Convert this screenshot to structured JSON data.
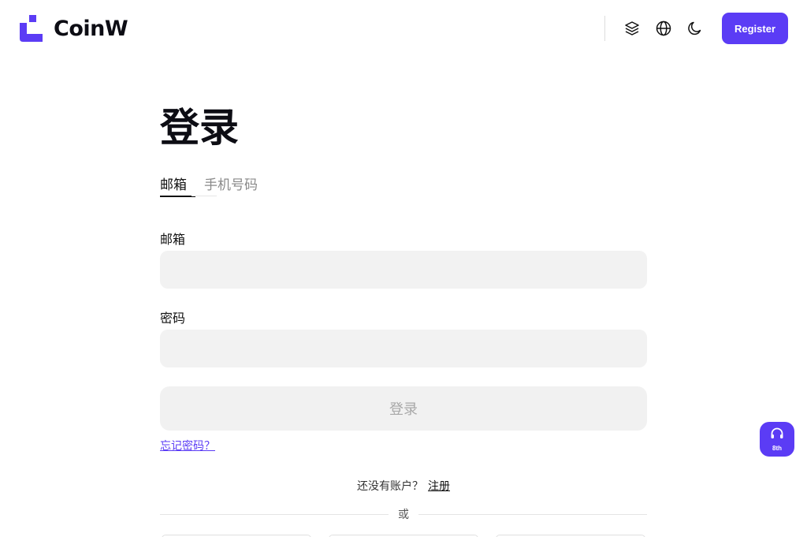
{
  "header": {
    "brand_name": "CoinW",
    "brand_color": "#5b3cf5",
    "icons": [
      "layers-icon",
      "globe-icon",
      "moon-icon"
    ],
    "register_label": "Register"
  },
  "main": {
    "title": "登录",
    "tabs": [
      {
        "label": "邮箱",
        "active": true
      },
      {
        "label": "手机号码",
        "active": false
      }
    ],
    "fields": [
      {
        "label": "邮箱",
        "value": "",
        "placeholder": ""
      },
      {
        "label": "密码",
        "value": "",
        "placeholder": ""
      }
    ],
    "submit_label": "登录",
    "forgot_label": "忘记密码？",
    "signup_prompt": "还没有账户？",
    "signup_link": "注册",
    "divider_text": "或"
  },
  "support": {
    "icon": "headset-icon",
    "badge": "8th"
  }
}
